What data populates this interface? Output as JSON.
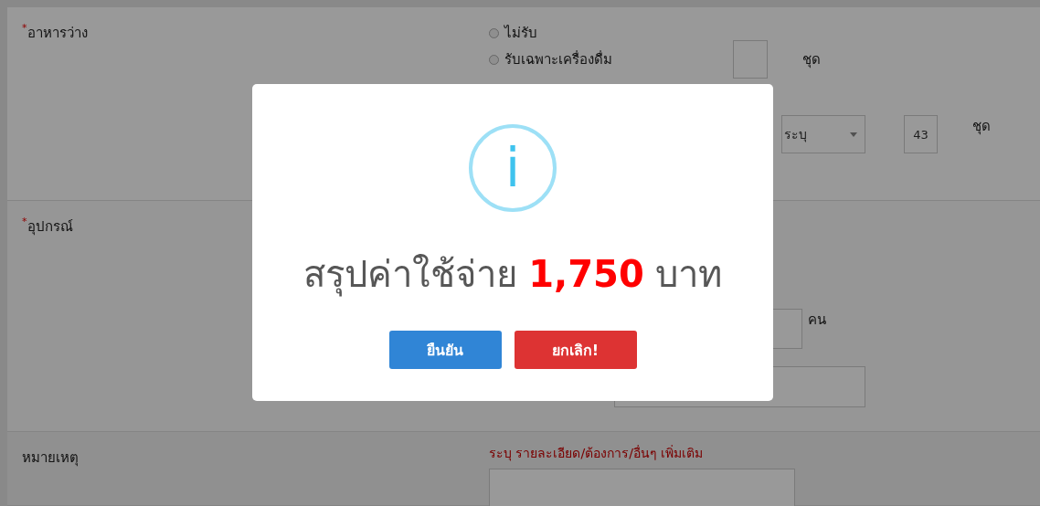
{
  "form": {
    "snack": {
      "label": "อาหารว่าง",
      "required_mark": "*",
      "options": [
        {
          "label": "ไม่รับ",
          "selected": false
        },
        {
          "label": "รับเฉพาะเครื่องดื่ม",
          "selected": false
        }
      ],
      "drink_unit": "ชุด",
      "select_value": "ระบุ",
      "count_value": "43",
      "count_unit": "ชุด"
    },
    "equipment": {
      "label": "อุปกรณ์",
      "required_mark": "*",
      "people_unit": "คน"
    },
    "note": {
      "label": "หมายเหตุ",
      "hint": "ระบุ รายละเอียด/ต้องการ/อื่นๆ เพิ่มเติม"
    }
  },
  "dialog": {
    "icon": "i",
    "title_prefix": "สรุปค่าใช้จ่าย",
    "amount": "1,750",
    "title_suffix": "บาท",
    "buttons": [
      {
        "kind": "confirm",
        "label": "ยืนยัน"
      },
      {
        "kind": "cancel",
        "label": "ยกเลิก!"
      }
    ]
  }
}
